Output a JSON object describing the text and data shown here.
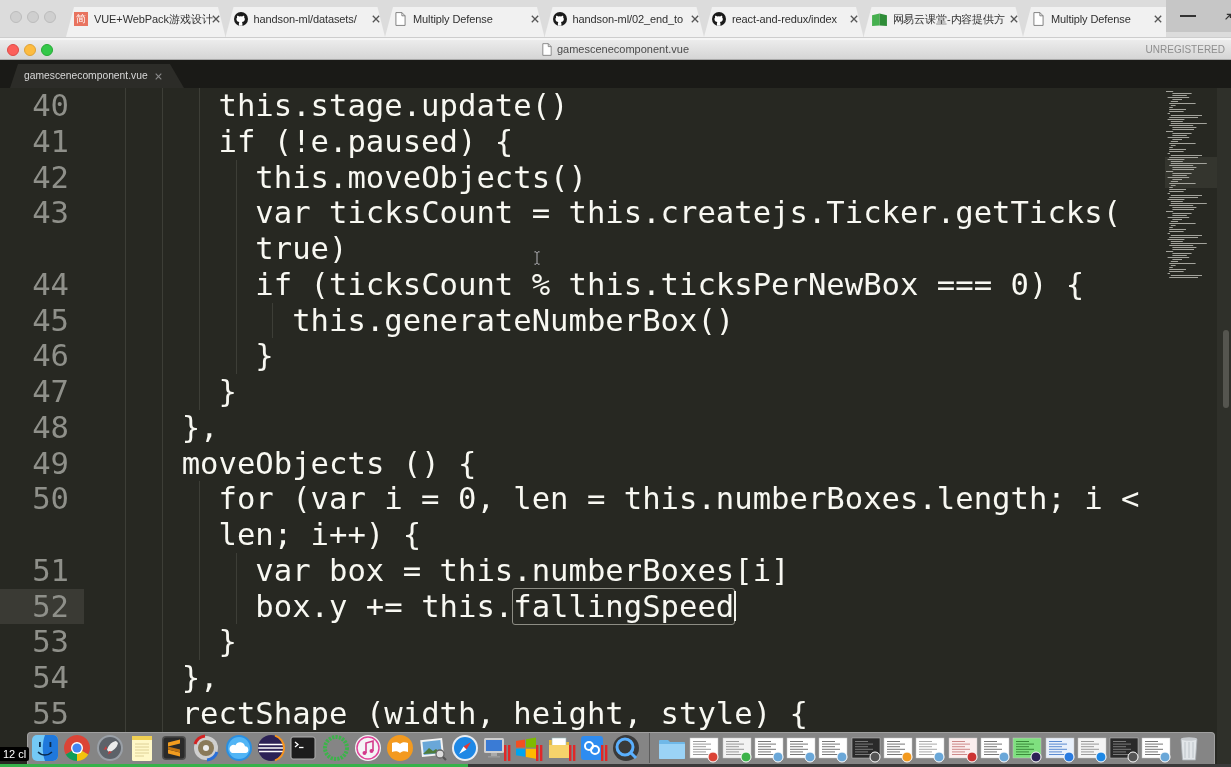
{
  "browser": {
    "tabs": [
      {
        "favicon": {
          "kind": "letter",
          "text": "简"
        },
        "title": "VUE+WebPack游戏设计"
      },
      {
        "favicon": {
          "kind": "cat"
        },
        "title": "handson-ml/datasets/"
      },
      {
        "favicon": {
          "kind": "page"
        },
        "title": "Multiply Defense"
      },
      {
        "favicon": {
          "kind": "cat"
        },
        "title": "handson-ml/02_end_to"
      },
      {
        "favicon": {
          "kind": "cat"
        },
        "title": "react-and-redux/index"
      },
      {
        "favicon": {
          "kind": "book"
        },
        "title": "网易云课堂-内容提供方"
      },
      {
        "favicon": {
          "kind": "page"
        },
        "title": "Multiply Defense"
      }
    ]
  },
  "window": {
    "title": "gamescenecomponent.vue",
    "status": "UNREGISTERED"
  },
  "tabs": [
    {
      "label": "gamescenecomponent.vue"
    }
  ],
  "editor": {
    "lines": [
      {
        "number": "40",
        "current": false,
        "rows": [
          "      this.stage.update()"
        ]
      },
      {
        "number": "41",
        "current": false,
        "rows": [
          "      if (!e.paused) {"
        ]
      },
      {
        "number": "42",
        "current": false,
        "rows": [
          "        this.moveObjects()"
        ]
      },
      {
        "number": "43",
        "current": false,
        "rows": [
          "        var ticksCount = this.createjs.Ticker.getTicks(",
          "        true)"
        ]
      },
      {
        "number": "44",
        "current": false,
        "rows": [
          "        if (ticksCount % this.ticksPerNewBox === 0) {"
        ]
      },
      {
        "number": "45",
        "current": false,
        "rows": [
          "          this.generateNumberBox()"
        ]
      },
      {
        "number": "46",
        "current": false,
        "rows": [
          "        }"
        ]
      },
      {
        "number": "47",
        "current": false,
        "rows": [
          "      }"
        ]
      },
      {
        "number": "48",
        "current": false,
        "rows": [
          "    },"
        ]
      },
      {
        "number": "49",
        "current": false,
        "rows": [
          "    moveObjects () {"
        ]
      },
      {
        "number": "50",
        "current": false,
        "rows": [
          "      for (var i = 0, len = this.numberBoxes.length; i <",
          "      len; i++) {"
        ]
      },
      {
        "number": "51",
        "current": false,
        "rows": [
          "        var box = this.numberBoxes[i]"
        ]
      },
      {
        "number": "52",
        "current": true,
        "rows": [
          "        box.y += this."
        ],
        "highlighted": "fallingSpeed"
      },
      {
        "number": "53",
        "current": false,
        "rows": [
          "      }"
        ]
      },
      {
        "number": "54",
        "current": false,
        "rows": [
          "    },"
        ]
      },
      {
        "number": "55",
        "current": false,
        "rows": [
          "    rectShape (width, height, style) {"
        ]
      }
    ]
  },
  "video_overlay": {
    "label": "12 cl",
    "progress": {
      "level": 0.38
    }
  }
}
